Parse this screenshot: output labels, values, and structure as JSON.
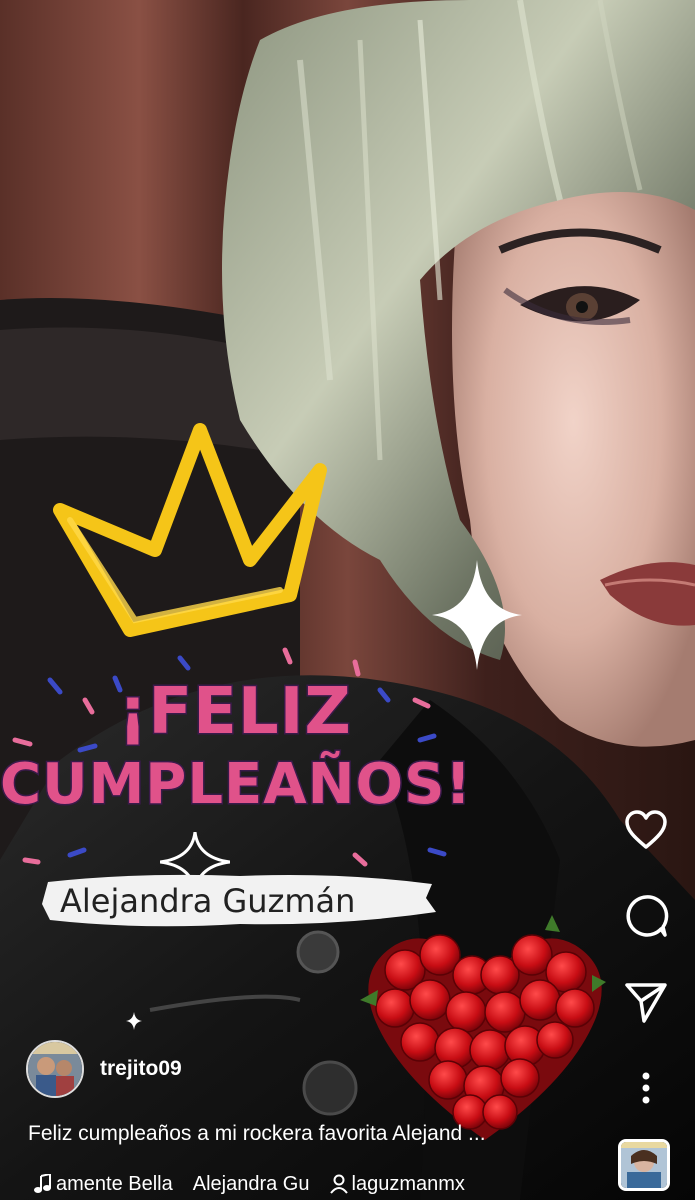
{
  "post": {
    "overlay": {
      "line1": "¡FELIZ",
      "line2": "CUMPLEAÑOS!",
      "name": "Alejandra Guzmán"
    }
  },
  "actions": {
    "like": "heart-icon",
    "comment": "comment-bubble-icon",
    "share": "paper-plane-icon",
    "more": "more-options-icon"
  },
  "author": {
    "username": "trejito09"
  },
  "caption": "Feliz cumpleaños a mi rockera favorita Alejand ...",
  "audio": {
    "song_title": "amente Bella",
    "artist": "Alejandra Gu",
    "tagged_user": "laguzmanmx"
  },
  "colors": {
    "title_pink": "#e0528a",
    "crown_yellow": "#f5c518",
    "text_white": "#ffffff"
  }
}
